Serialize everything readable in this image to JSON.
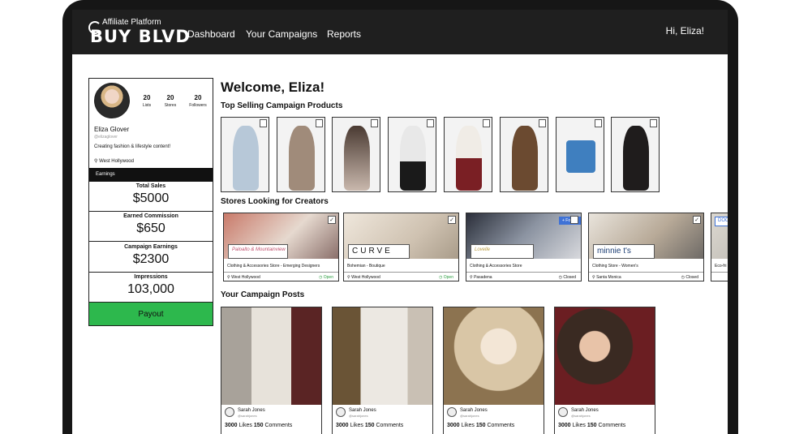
{
  "header": {
    "logo_top": "Affiliate Platform",
    "logo_main": "BUY BLVD",
    "nav": [
      "Dashboard",
      "Your Campaigns",
      "Reports"
    ],
    "greeting": "Hi, Eliza!"
  },
  "profile": {
    "lists": "20",
    "lists_label": "Lists",
    "stores": "20",
    "stores_label": "Stores",
    "followers": "20",
    "followers_label": "Followers",
    "name": "Eliza Glover",
    "handle": "@elizaglover",
    "bio": "Creating fashion & lifestyle content!",
    "location": "West Hollywood",
    "earnings_label": "Earnings",
    "metrics": [
      {
        "label": "Total Sales",
        "value": "$5000"
      },
      {
        "label": "Earned Commission",
        "value": "$650"
      },
      {
        "label": "Campaign Earnings",
        "value": "$2300"
      },
      {
        "label": "Impressions",
        "value": "103,000"
      }
    ],
    "payout_label": "Payout"
  },
  "main": {
    "welcome": "Welcome, Eliza!",
    "products_title": "Top Selling Campaign Products",
    "stores_title": "Stores Looking for Creators",
    "posts_title": "Your Campaign Posts"
  },
  "stores": [
    {
      "logo": "Paloalto & Mountainview",
      "type": "Clothing & Accessories Store - Emerging Designers",
      "location": "West Hollywood",
      "status": "Open",
      "status_color": "#2a9d3f"
    },
    {
      "logo": "CURVE",
      "type": "Bohemian - Boutique",
      "location": "West Hollywood",
      "status": "Open",
      "status_color": "#2a9d3f"
    },
    {
      "logo": "Lovelle",
      "type": "Clothing & Accessories Store",
      "location": "Pasadena",
      "status": "Closed",
      "status_color": "#333333",
      "follow": "+ Follow"
    },
    {
      "logo": "minnie t's",
      "type": "Clothing Store - Women's",
      "location": "Santa Monica",
      "status": "Closed",
      "status_color": "#333333"
    },
    {
      "logo": "DOO",
      "type": "Eco-fri",
      "location": "",
      "status": ""
    }
  ],
  "posts": [
    {
      "user": "Sarah Jones",
      "handle": "@sarahjones",
      "likes": "3000",
      "likes_label": "Likes",
      "comments": "150",
      "comments_label": "Comments"
    },
    {
      "user": "Sarah Jones",
      "handle": "@sarahjones",
      "likes": "3000",
      "likes_label": "Likes",
      "comments": "150",
      "comments_label": "Comments"
    },
    {
      "user": "Sarah Jones",
      "handle": "@sarahjones",
      "likes": "3000",
      "likes_label": "Likes",
      "comments": "150",
      "comments_label": "Comments"
    },
    {
      "user": "Sarah Jones",
      "handle": "@sarahjones",
      "likes": "3000",
      "likes_label": "Likes",
      "comments": "150",
      "comments_label": "Comments"
    }
  ],
  "colors": {
    "accent_green": "#2db84d",
    "navbar": "#1f1f1f",
    "follow_blue": "#3f72d6"
  }
}
